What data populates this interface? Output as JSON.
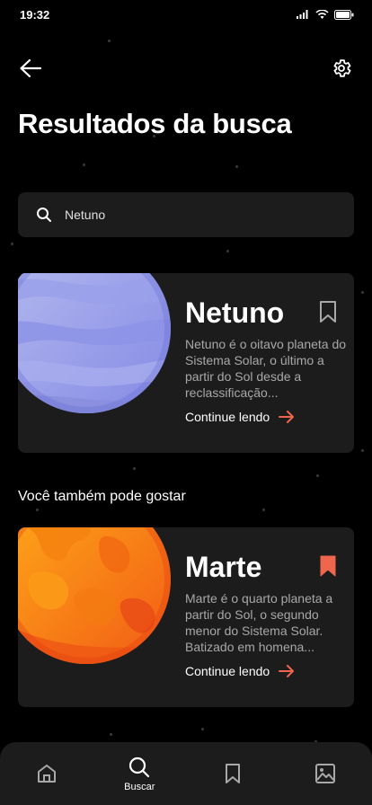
{
  "status": {
    "time": "19:32"
  },
  "header": {
    "title": "Resultados da busca"
  },
  "search": {
    "value": "Netuno",
    "placeholder": "Buscar"
  },
  "results": [
    {
      "title": "Netuno",
      "description": "Netuno é o oitavo planeta do Sistema Solar, o último a partir do Sol desde a reclassificação...",
      "link_label": "Continue lendo",
      "bookmarked": false
    }
  ],
  "suggestions": {
    "title": "Você também pode gostar",
    "items": [
      {
        "title": "Marte",
        "description": "Marte é o quarto planeta a partir do Sol, o segundo menor do Sistema Solar. Batizado em homena...",
        "link_label": "Continue lendo",
        "bookmarked": true
      }
    ]
  },
  "bottom_nav": {
    "items": [
      {
        "icon": "home-icon",
        "label": ""
      },
      {
        "icon": "search-icon",
        "label": "Buscar",
        "active": true
      },
      {
        "icon": "bookmark-icon",
        "label": ""
      },
      {
        "icon": "image-icon",
        "label": ""
      }
    ]
  },
  "colors": {
    "background": "#000000",
    "card": "#1c1c1c",
    "accent": "#f0654e",
    "muted_text": "#a8a8a8"
  }
}
